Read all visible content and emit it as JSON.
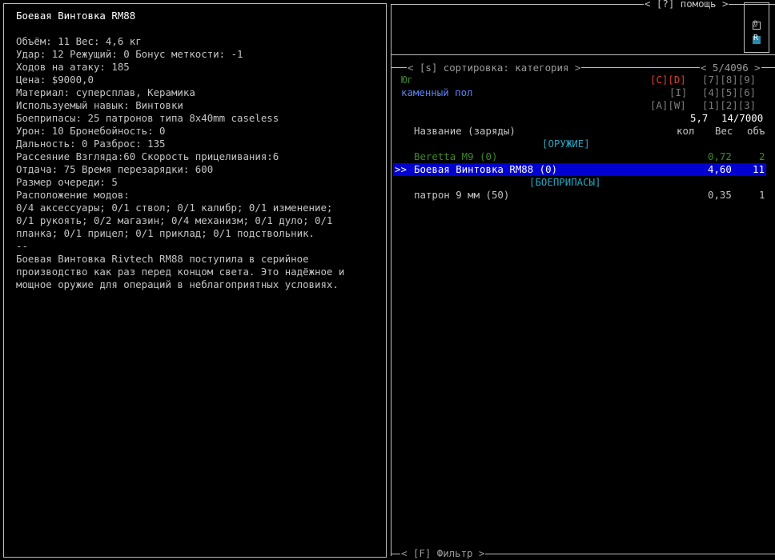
{
  "item_info": {
    "title": "Боевая Винтовка RM88",
    "lines": [
      "Объём: 11 Вес: 4,6 кг",
      "Удар: 12 Режущий: 0 Бонус меткости: -1",
      "Ходов на атаку: 185",
      "Цена: $9000,0",
      "Материал: суперсплав, Керамика",
      "Используемый навык: Винтовки",
      "Боеприпасы: 25 патронов типа 8x40mm caseless",
      "Урон: 10 Бронебойность: 0",
      "Дальность: 0 Разброс: 135",
      "Рассеяние Взгляда:60 Скорость прицеливания:6",
      "Отдача: 75 Время перезарядки: 600",
      "Размер очереди: 5",
      "Расположение модов:",
      "0/4 аксессуары; 0/1 ствол; 0/1 калибр; 0/1 изменение;",
      "0/1 рукоять; 0/2 магазин; 0/4 механизм; 0/1 дуло; 0/1",
      "планка; 0/1 прицел; 0/1 приклад; 0/1 подствольник.",
      "--",
      "Боевая Винтовка Rivtech RM88 поступила в серийное",
      "производство как раз перед концом света. Это надёжное и",
      "мощное оружие для операций в неблагоприятных условиях."
    ]
  },
  "help_label": "< [?] помощь >",
  "side_tabs": [
    "@",
    "R"
  ],
  "inventory": {
    "sort_label": "< [s] сортировка: категория >",
    "page_count": "< 5/4096 >",
    "direction": "Юг",
    "location": "каменный пол",
    "keys_row1_active": "[C][D]",
    "keys_row1_numbers": "[7][8][9]",
    "keys_row2_a": "[I]",
    "keys_row2_numbers": "[4][5][6]",
    "keys_row3_a": "[A][W]",
    "keys_row3_numbers": "[1][2][3]",
    "weight_total": "5,7",
    "volume_total": "14/7000",
    "columns": {
      "name": "Название (заряды)",
      "count": "кол",
      "weight": "Вес",
      "volume": "объ"
    },
    "categories": [
      {
        "label": "[ОРУЖИЕ]",
        "items": [
          {
            "cursor": "",
            "name": "Beretta M9 (0)",
            "weight": "0,72",
            "volume": "2",
            "state": "unavailable"
          },
          {
            "cursor": ">>",
            "name": "Боевая Винтовка RM88 (0)",
            "weight": "4,60",
            "volume": "11",
            "state": "selected"
          }
        ]
      },
      {
        "label": "[БОЕПРИПАСЫ]",
        "items": [
          {
            "cursor": "",
            "name": "патрон 9 мм (50)",
            "weight": "0,35",
            "volume": "1",
            "state": "normal"
          }
        ]
      }
    ],
    "filter_label": "< [F] Фильтр >"
  },
  "colors": {
    "background": "#000000",
    "text": "#c4c4c4",
    "border": "#bdbdbd",
    "selection": "#0000d0",
    "direction": "#3d8a2c",
    "location": "#5c84f3",
    "active_keys": "#e23a2e",
    "category": "#2aa4bf"
  }
}
